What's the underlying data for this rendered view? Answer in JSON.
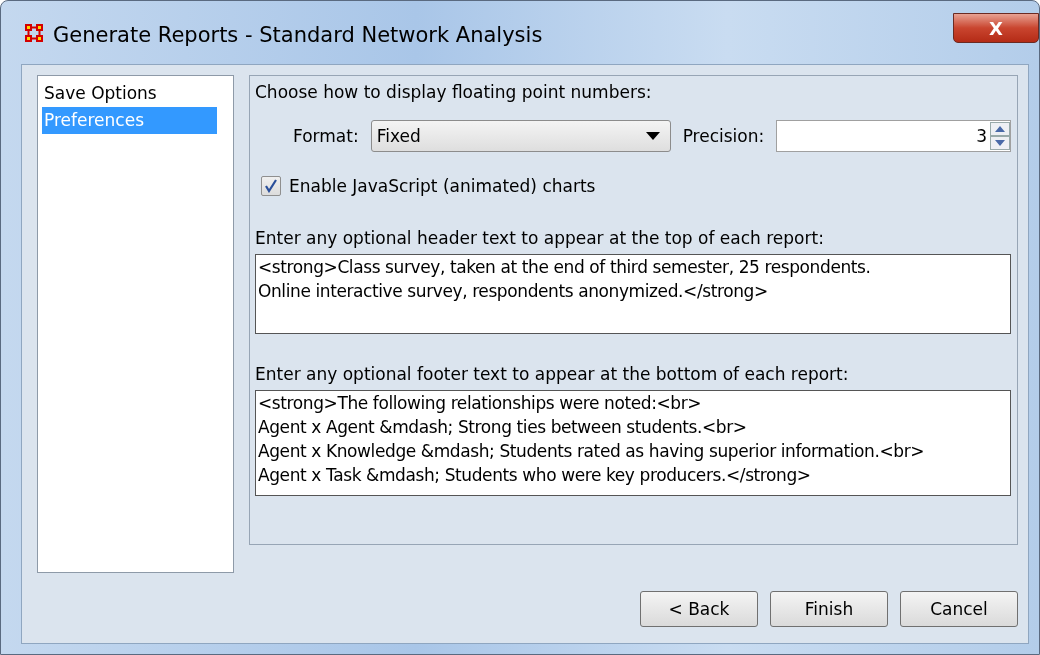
{
  "window": {
    "title": "Generate Reports - Standard Network Analysis",
    "close": "X"
  },
  "sidebar": {
    "items": [
      {
        "label": "Save Options",
        "selected": false
      },
      {
        "label": "Preferences",
        "selected": true
      }
    ]
  },
  "panel": {
    "number_heading": "Choose how to display floating point numbers:",
    "format": {
      "label": "Format:",
      "value": "Fixed"
    },
    "precision": {
      "label": "Precision:",
      "value": "3"
    },
    "js_charts": {
      "label": "Enable JavaScript (animated) charts",
      "checked": true
    },
    "header": {
      "label": "Enter any optional header text to appear at the top of each report:",
      "lines": [
        "<strong>Class survey, taken at the end of third semester, 25 respondents.",
        "Online interactive survey, respondents anonymized.</strong>"
      ]
    },
    "footer": {
      "label": "Enter any optional footer text to appear at the bottom of each report:",
      "lines": [
        "<strong>The following relationships were noted:<br>",
        "Agent x Agent &mdash; Strong ties between students.<br>",
        "Agent x Knowledge &mdash; Students rated as having superior information.<br>",
        "Agent x Task &mdash; Students who were key producers.</strong>"
      ]
    }
  },
  "buttons": [
    "< Back",
    "Finish",
    "Cancel"
  ]
}
